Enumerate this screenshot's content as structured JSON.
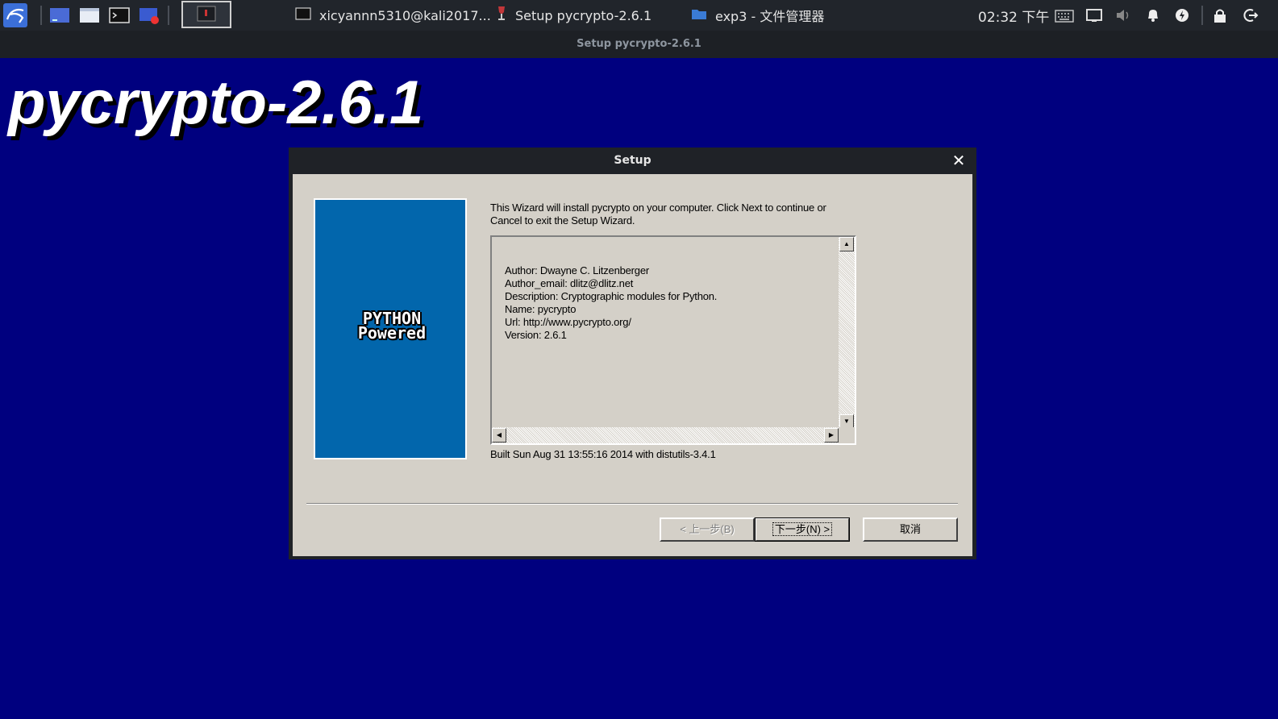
{
  "taskbar": {
    "tasks": [
      {
        "label": "xicyannn5310@kali2017...",
        "icon": "terminal-icon"
      },
      {
        "label": "Setup pycrypto-2.6.1",
        "icon": "wine-icon"
      },
      {
        "label": "exp3 - 文件管理器",
        "icon": "folder-icon"
      }
    ],
    "clock": "02:32 下午",
    "tray_icons": [
      "keyboard-icon",
      "display-icon",
      "volume-icon",
      "bell-icon",
      "power-icon",
      "lock-icon",
      "logout-icon"
    ]
  },
  "window": {
    "title": "Setup pycrypto-2.6.1"
  },
  "heading": "pycrypto-2.6.1",
  "dialog": {
    "title": "Setup",
    "intro_line1": "This Wizard will install pycrypto on your computer. Click Next to continue or",
    "intro_line2": "Cancel to exit the Setup Wizard.",
    "bitmap_line1": "PYTHON",
    "bitmap_line2": "Powered",
    "info": [
      "Author: Dwayne C. Litzenberger",
      "Author_email: dlitz@dlitz.net",
      "Description: Cryptographic modules for Python.",
      "Name: pycrypto",
      "Url: http://www.pycrypto.org/",
      "Version: 2.6.1"
    ],
    "built": "Built Sun Aug 31 13:55:16 2014 with distutils-3.4.1",
    "buttons": {
      "back": "< 上一步(B)",
      "next": "下一步(N) >",
      "cancel": "取消"
    }
  },
  "colors": {
    "desktop": "#00007f",
    "taskbar": "#21252b",
    "dialog_face": "#d4d0c8",
    "bitmap_blue": "#0266ac"
  }
}
